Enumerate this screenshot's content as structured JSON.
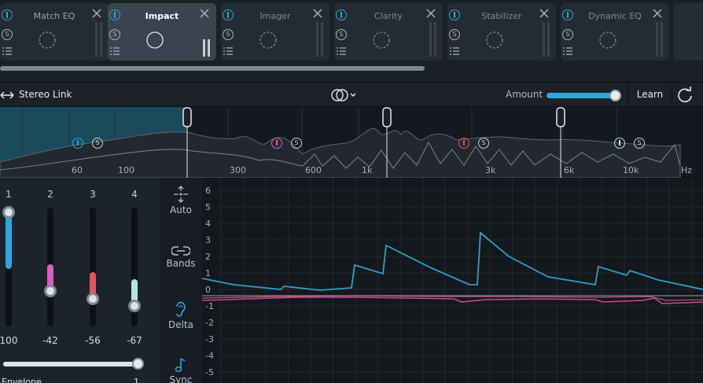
{
  "modules": [
    {
      "title": "Match EQ",
      "active": false,
      "dim": false
    },
    {
      "title": "Impact",
      "active": true,
      "dim": false
    },
    {
      "title": "Imager",
      "active": false,
      "dim": true
    },
    {
      "title": "Clarity",
      "active": false,
      "dim": true
    },
    {
      "title": "Stabilizer",
      "active": false,
      "dim": true
    },
    {
      "title": "Dynamic EQ",
      "active": false,
      "dim": true
    }
  ],
  "module_solo_glyph": "S",
  "stereo_link": {
    "label": "Stereo Link"
  },
  "amount": {
    "label": "Amount",
    "value": 1.0
  },
  "learn_label": "Learn",
  "spectrum": {
    "freq_labels": [
      "60",
      "100",
      "300",
      "600",
      "1k",
      "3k",
      "6k",
      "10k",
      "Hz"
    ],
    "solo_glyph": "S",
    "band_colors": [
      "#2ba7dc",
      "#e05bc0",
      "#e5545a",
      "#c7dce0"
    ]
  },
  "bands": [
    {
      "num": "1",
      "value": "100",
      "level": 1.0,
      "color": "#2ba7dc"
    },
    {
      "num": "2",
      "value": "-42",
      "level": 0.31,
      "color": "#e05bc0"
    },
    {
      "num": "3",
      "value": "-56",
      "level": 0.24,
      "color": "#e5545a"
    },
    {
      "num": "4",
      "value": "-67",
      "level": 0.18,
      "color": "#b6e2e6"
    }
  ],
  "envelope": {
    "label": "Envelope",
    "value": "1",
    "level": 1.0
  },
  "tools": [
    {
      "label": "Auto",
      "icon": "auto-icon",
      "active": false
    },
    {
      "label": "Bands",
      "icon": "link-bands-icon",
      "active": false
    },
    {
      "label": "Delta",
      "icon": "ear-icon",
      "active": true
    },
    {
      "label": "Sync",
      "icon": "note-icon",
      "active": true
    }
  ],
  "graph": {
    "y_ticks": [
      "6",
      "5",
      "4",
      "3",
      "2",
      "1",
      "0",
      "-1",
      "-2",
      "-3",
      "-4",
      "-5"
    ]
  },
  "colors": {
    "accent": "#2ba7dc",
    "pink": "#c8478f",
    "red": "#e5545a"
  }
}
